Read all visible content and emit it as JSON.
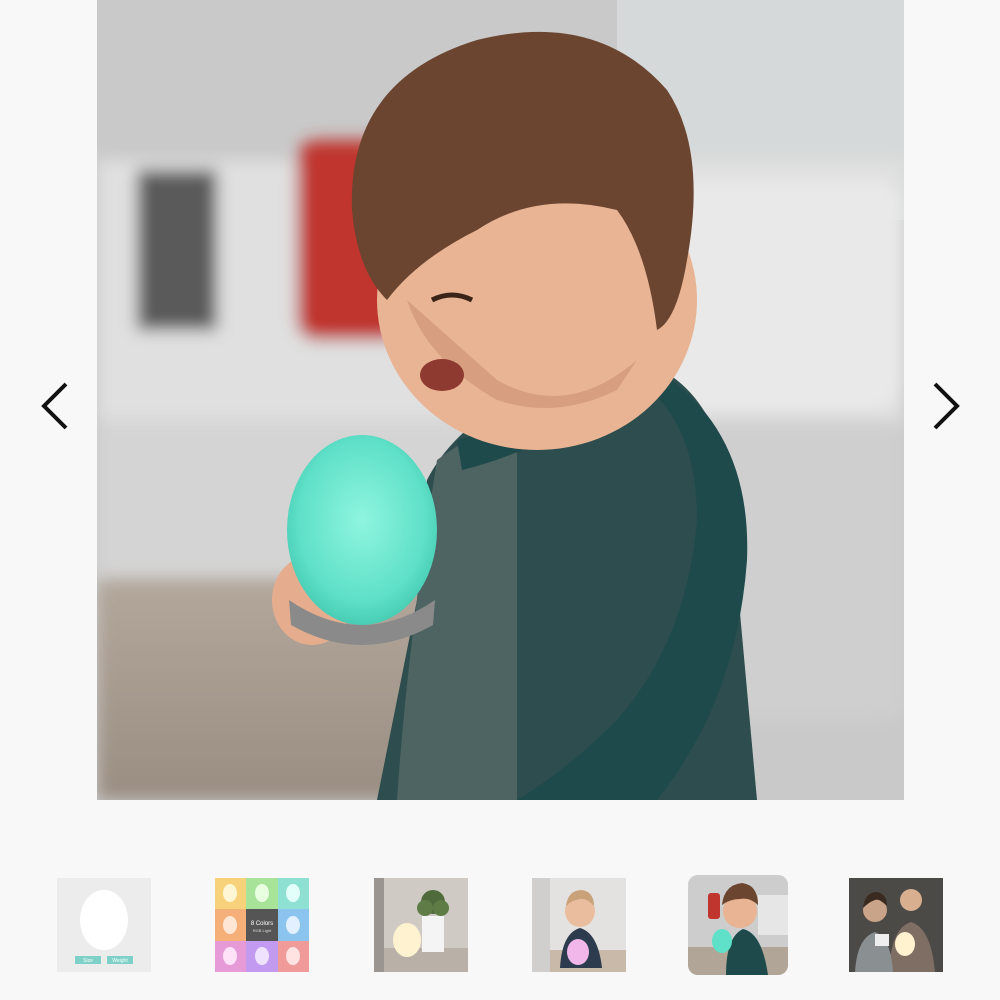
{
  "gallery": {
    "prev_button": {
      "icon": "chevron-left-icon"
    },
    "next_button": {
      "icon": "chevron-right-icon"
    },
    "main_image": {
      "subject": "toddler holding glowing teal egg night light"
    },
    "thumbnails": [
      {
        "subject": "white egg lamp product shot",
        "label_left": "Size",
        "label_right": "Weight"
      },
      {
        "subject": "8 colors grid",
        "center_title": "8 Colors",
        "center_sub": "RGB Light"
      },
      {
        "subject": "lamp beside potted plant"
      },
      {
        "subject": "toddler with pink lamp"
      },
      {
        "subject": "toddler with teal lamp"
      },
      {
        "subject": "family reading by lamp"
      }
    ],
    "active_index": 4
  },
  "colors": {
    "background": "#f8f8f8",
    "lamp_glow": "#5fe0c8",
    "shirt": "#1f4a4c",
    "arrow": "#111111"
  }
}
